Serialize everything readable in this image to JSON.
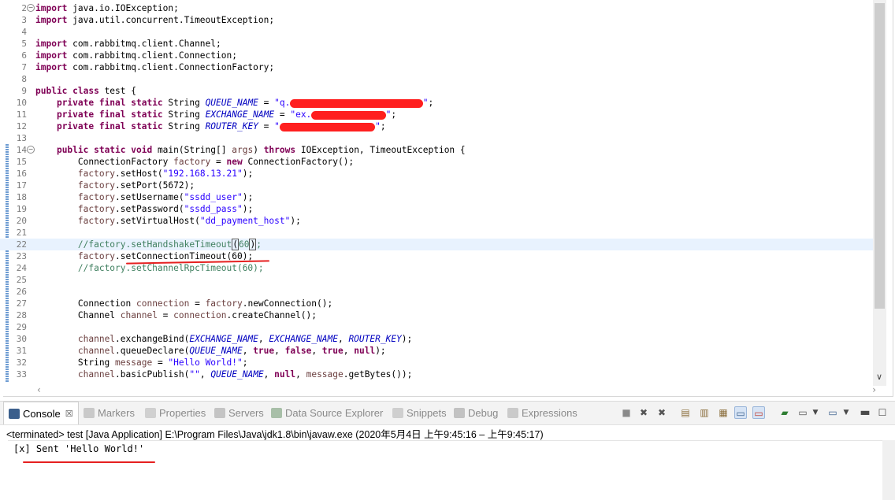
{
  "editor": {
    "lines": [
      {
        "n": "2",
        "fold": "⊖",
        "t": [
          [
            "kw",
            "import"
          ],
          [
            "p",
            " java.io.IOException;"
          ]
        ]
      },
      {
        "n": "3",
        "t": [
          [
            "kw",
            "import"
          ],
          [
            "p",
            " java.util.concurrent.TimeoutException;"
          ]
        ]
      },
      {
        "n": "4",
        "t": []
      },
      {
        "n": "5",
        "t": [
          [
            "kw",
            "import"
          ],
          [
            "p",
            " com.rabbitmq.client.Channel;"
          ]
        ]
      },
      {
        "n": "6",
        "t": [
          [
            "kw",
            "import"
          ],
          [
            "p",
            " com.rabbitmq.client.Connection;"
          ]
        ]
      },
      {
        "n": "7",
        "t": [
          [
            "kw",
            "import"
          ],
          [
            "p",
            " com.rabbitmq.client.ConnectionFactory;"
          ]
        ]
      },
      {
        "n": "8",
        "t": []
      },
      {
        "n": "9",
        "t": [
          [
            "kw",
            "public class"
          ],
          [
            "p",
            " test {"
          ]
        ]
      },
      {
        "n": "10",
        "t": [
          [
            "p",
            "    "
          ],
          [
            "kw",
            "private final static"
          ],
          [
            "p",
            " String "
          ],
          [
            "fld",
            "QUEUE_NAME"
          ],
          [
            "p",
            " = "
          ],
          [
            "str",
            "\"q."
          ],
          [
            "redact",
            "xxxxxxxxxxxxxxxxxxxxxxxxx"
          ],
          [
            "str",
            "\""
          ],
          [
            "p",
            ";"
          ]
        ]
      },
      {
        "n": "11",
        "t": [
          [
            "p",
            "    "
          ],
          [
            "kw",
            "private final static"
          ],
          [
            "p",
            " String "
          ],
          [
            "fld",
            "EXCHANGE_NAME"
          ],
          [
            "p",
            " = "
          ],
          [
            "str",
            "\"ex."
          ],
          [
            "redact",
            "xxxxxxxxxxxxxx"
          ],
          [
            "str",
            "\""
          ],
          [
            "p",
            ";"
          ]
        ]
      },
      {
        "n": "12",
        "t": [
          [
            "p",
            "    "
          ],
          [
            "kw",
            "private final static"
          ],
          [
            "p",
            " String "
          ],
          [
            "fld",
            "ROUTER_KEY"
          ],
          [
            "p",
            " = "
          ],
          [
            "str",
            "\""
          ],
          [
            "redact",
            "xxxxxxxxxxxxxxxxxx"
          ],
          [
            "str",
            "\""
          ],
          [
            "p",
            ";"
          ]
        ]
      },
      {
        "n": "13",
        "t": []
      },
      {
        "n": "14",
        "fold": "⊖",
        "t": [
          [
            "p",
            "    "
          ],
          [
            "kw",
            "public static void"
          ],
          [
            "p",
            " main(String[] "
          ],
          [
            "var",
            "args"
          ],
          [
            "p",
            ") "
          ],
          [
            "kw",
            "throws"
          ],
          [
            "p",
            " IOException, TimeoutException {"
          ]
        ]
      },
      {
        "n": "15",
        "t": [
          [
            "p",
            "        ConnectionFactory "
          ],
          [
            "var",
            "factory"
          ],
          [
            "p",
            " = "
          ],
          [
            "kw",
            "new"
          ],
          [
            "p",
            " ConnectionFactory();"
          ]
        ]
      },
      {
        "n": "16",
        "t": [
          [
            "p",
            "        "
          ],
          [
            "var",
            "factory"
          ],
          [
            "p",
            ".setHost("
          ],
          [
            "str",
            "\"192.168.13.21\""
          ],
          [
            "p",
            ");"
          ]
        ]
      },
      {
        "n": "17",
        "t": [
          [
            "p",
            "        "
          ],
          [
            "var",
            "factory"
          ],
          [
            "p",
            ".setPort(5672);"
          ]
        ]
      },
      {
        "n": "18",
        "t": [
          [
            "p",
            "        "
          ],
          [
            "var",
            "factory"
          ],
          [
            "p",
            ".setUsername("
          ],
          [
            "str",
            "\"ssdd_user\""
          ],
          [
            "p",
            ");"
          ]
        ]
      },
      {
        "n": "19",
        "t": [
          [
            "p",
            "        "
          ],
          [
            "var",
            "factory"
          ],
          [
            "p",
            ".setPassword("
          ],
          [
            "str",
            "\"ssdd_pass\""
          ],
          [
            "p",
            ");"
          ]
        ]
      },
      {
        "n": "20",
        "t": [
          [
            "p",
            "        "
          ],
          [
            "var",
            "factory"
          ],
          [
            "p",
            ".setVirtualHost("
          ],
          [
            "str",
            "\"dd_payment_host\""
          ],
          [
            "p",
            ");"
          ]
        ]
      },
      {
        "n": "21",
        "t": []
      },
      {
        "n": "22",
        "current": true,
        "t": [
          [
            "p",
            "        "
          ],
          [
            "cm",
            "//factory.setHandshakeTimeout"
          ],
          [
            "cursor",
            "("
          ],
          [
            "cm",
            "60"
          ],
          [
            "cursor",
            ")"
          ],
          [
            "cm",
            ";"
          ]
        ]
      },
      {
        "n": "23",
        "t": [
          [
            "p",
            "        "
          ],
          [
            "var",
            "factory"
          ],
          [
            "p",
            ".setConnectionTimeout(60);"
          ]
        ]
      },
      {
        "n": "24",
        "t": [
          [
            "p",
            "        "
          ],
          [
            "cm",
            "//factory.setChannelRpcTimeout(60);"
          ]
        ]
      },
      {
        "n": "25",
        "t": []
      },
      {
        "n": "26",
        "t": []
      },
      {
        "n": "27",
        "t": [
          [
            "p",
            "        Connection "
          ],
          [
            "var",
            "connection"
          ],
          [
            "p",
            " = "
          ],
          [
            "var",
            "factory"
          ],
          [
            "p",
            ".newConnection();"
          ]
        ]
      },
      {
        "n": "28",
        "t": [
          [
            "p",
            "        Channel "
          ],
          [
            "var",
            "channel"
          ],
          [
            "p",
            " = "
          ],
          [
            "var",
            "connection"
          ],
          [
            "p",
            ".createChannel();"
          ]
        ]
      },
      {
        "n": "29",
        "t": []
      },
      {
        "n": "30",
        "t": [
          [
            "p",
            "        "
          ],
          [
            "var",
            "channel"
          ],
          [
            "p",
            ".exchangeBind("
          ],
          [
            "fld",
            "EXCHANGE_NAME"
          ],
          [
            "p",
            ", "
          ],
          [
            "fld",
            "EXCHANGE_NAME"
          ],
          [
            "p",
            ", "
          ],
          [
            "fld",
            "ROUTER_KEY"
          ],
          [
            "p",
            ");"
          ]
        ]
      },
      {
        "n": "31",
        "t": [
          [
            "p",
            "        "
          ],
          [
            "var",
            "channel"
          ],
          [
            "p",
            ".queueDeclare("
          ],
          [
            "fld",
            "QUEUE_NAME"
          ],
          [
            "p",
            ", "
          ],
          [
            "kw",
            "true"
          ],
          [
            "p",
            ", "
          ],
          [
            "kw",
            "false"
          ],
          [
            "p",
            ", "
          ],
          [
            "kw",
            "true"
          ],
          [
            "p",
            ", "
          ],
          [
            "kw",
            "null"
          ],
          [
            "p",
            ");"
          ]
        ]
      },
      {
        "n": "32",
        "t": [
          [
            "p",
            "        String "
          ],
          [
            "var",
            "message"
          ],
          [
            "p",
            " = "
          ],
          [
            "str",
            "\"Hello World!\""
          ],
          [
            "p",
            ";"
          ]
        ]
      },
      {
        "n": "33",
        "t": [
          [
            "p",
            "        "
          ],
          [
            "var",
            "channel"
          ],
          [
            "p",
            ".basicPublish("
          ],
          [
            "str",
            "\"\""
          ],
          [
            "p",
            ", "
          ],
          [
            "fld",
            "QUEUE_NAME"
          ],
          [
            "p",
            ", "
          ],
          [
            "kw",
            "null"
          ],
          [
            "p",
            ", "
          ],
          [
            "var",
            "message"
          ],
          [
            "p",
            ".getBytes());"
          ]
        ]
      }
    ]
  },
  "console": {
    "tabs": [
      {
        "label": "Console",
        "icon": "console-icon",
        "active": true
      },
      {
        "label": "Markers",
        "icon": "markers-icon"
      },
      {
        "label": "Properties",
        "icon": "properties-icon"
      },
      {
        "label": "Servers",
        "icon": "servers-icon"
      },
      {
        "label": "Data Source Explorer",
        "icon": "data-source-explorer-icon"
      },
      {
        "label": "Snippets",
        "icon": "snippets-icon"
      },
      {
        "label": "Debug",
        "icon": "debug-icon"
      },
      {
        "label": "Expressions",
        "icon": "expressions-icon"
      }
    ],
    "close_glyph": "☒",
    "terminated": "<terminated> test [Java Application] E:\\Program Files\\Java\\jdk1.8\\bin\\javaw.exe  (2020年5月4日 上午9:45:16 – 上午9:45:17)",
    "output": "[x] Sent 'Hello World!'"
  },
  "colors": {
    "keyword": "#7f0055",
    "string": "#2a00ff",
    "comment": "#3f7f5f",
    "field": "#0000c0",
    "local_var": "#6a3e3e",
    "annotation_red": "#e52020"
  }
}
